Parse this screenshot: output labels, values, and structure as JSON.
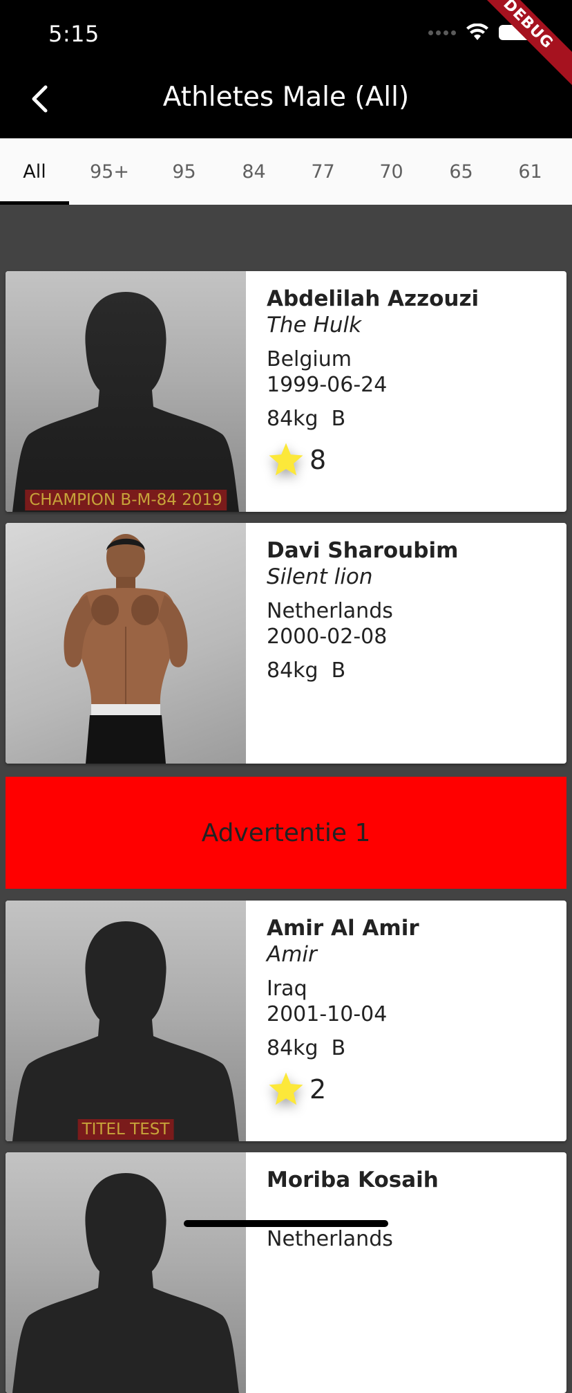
{
  "status_bar": {
    "time": "5:15"
  },
  "debug_label": "DEBUG",
  "app_bar": {
    "title": "Athletes Male (All)"
  },
  "tabs": [
    {
      "label": "All",
      "active": true
    },
    {
      "label": "95+"
    },
    {
      "label": "95"
    },
    {
      "label": "84"
    },
    {
      "label": "77"
    },
    {
      "label": "70"
    },
    {
      "label": "65"
    },
    {
      "label": "61"
    }
  ],
  "athletes": [
    {
      "name": "Abdelilah Azzouzi",
      "nickname": "The Hulk",
      "country": "Belgium",
      "dob": "1999-06-24",
      "weight": "84kg  B",
      "stars": "8",
      "title": "CHAMPION B-M-84 2019",
      "photo": "silhouette-placeholder"
    },
    {
      "name": "Davi Sharoubim",
      "nickname": "Silent lion",
      "country": "Netherlands",
      "dob": "2000-02-08",
      "weight": "84kg  B",
      "photo": "athlete-photo"
    },
    {
      "name": "Amir Al Amir",
      "nickname": "Amir",
      "country": "Iraq",
      "dob": "2001-10-04",
      "weight": "84kg  B",
      "stars": "2",
      "title": "TITEL TEST",
      "photo": "silhouette-placeholder"
    },
    {
      "name": "Moriba Kosaih",
      "country": "Netherlands",
      "photo": "silhouette-placeholder"
    }
  ],
  "ad": {
    "label": "Advertentie 1",
    "color": "#ff0000"
  },
  "colors": {
    "app_bar": "#000000",
    "background": "#434343",
    "star": "#fce83a",
    "badge_bg": "#7a1b1b",
    "badge_text": "#c7a43a"
  }
}
